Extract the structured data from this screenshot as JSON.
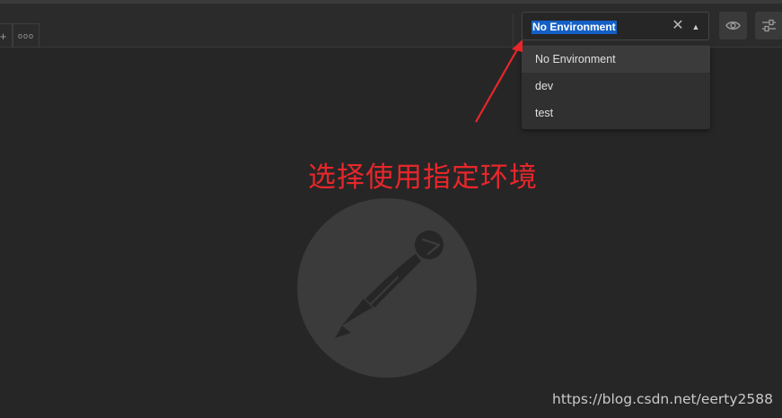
{
  "toolbar": {
    "tab_add_icon": "plus-icon",
    "tab_more_label": "ooo",
    "environment": {
      "selected": "No Environment",
      "clear_icon": "close-icon",
      "caret_icon": "caret-up-icon",
      "clear_glyph": "✕",
      "caret_glyph": "▲"
    },
    "eye_icon": "eye-icon",
    "settings_icon": "sliders-icon"
  },
  "dropdown": {
    "options": [
      "No Environment",
      "dev",
      "test"
    ]
  },
  "annotation": {
    "text": "选择使用指定环境",
    "color": "#e8262b"
  },
  "watermark": "https://blog.csdn.net/eerty2588",
  "colors": {
    "selection_highlight": "#1460c6",
    "background": "#262626"
  }
}
